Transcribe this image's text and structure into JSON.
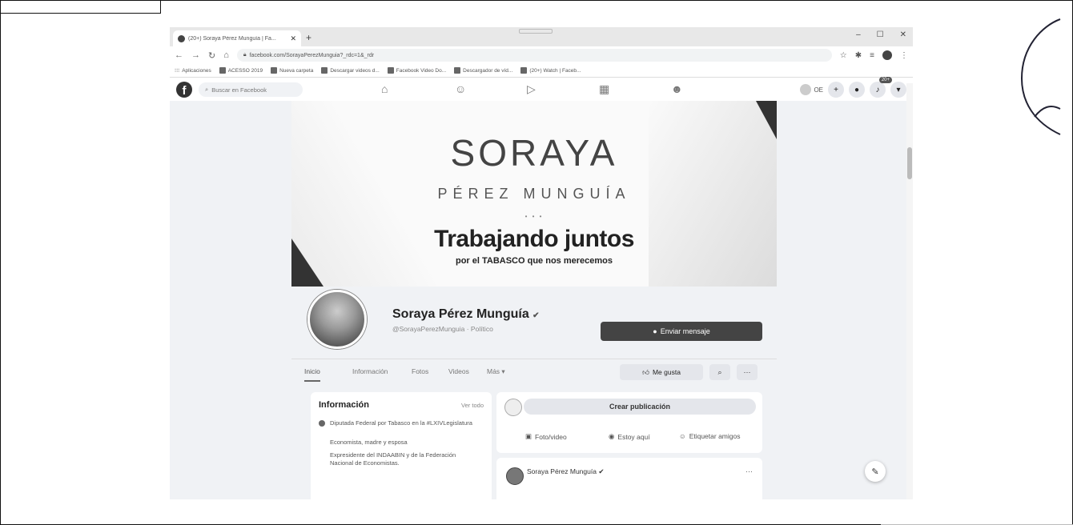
{
  "browser": {
    "tab_title": "(20+) Soraya Pérez Munguía | Fa...",
    "tab_close": "✕",
    "new_tab": "+",
    "url": "facebook.com/SorayaPerezMunguia?_rdc=1&_rdr",
    "window_controls": [
      "–",
      "☐",
      "✕"
    ]
  },
  "bookmarks": [
    "Aplicaciones",
    "ACESSO 2019",
    "Nueva carpeta",
    "Descargar videos d...",
    "Facebook Video Do...",
    "Descargador de víd...",
    "(20+) Watch | Faceb..."
  ],
  "fb": {
    "search_placeholder": "Buscar en Facebook",
    "user_short": "OE",
    "notifications_badge": "20+"
  },
  "cover": {
    "brand_name": "SORAYA",
    "brand_subtitle": "PÉREZ MUNGUÍA",
    "slogan": "Trabajando juntos",
    "slogan_sub": "por el TABASCO que nos merecemos"
  },
  "profile": {
    "name": "Soraya Pérez Munguía",
    "handle": "@SorayaPerezMunguia · Político",
    "message_button": "Enviar mensaje"
  },
  "tabs": [
    "Inicio",
    "Información",
    "Fotos",
    "Videos",
    "Más ▾"
  ],
  "actions": {
    "like": "Me gusta",
    "search": "⌕",
    "more": "···"
  },
  "info": {
    "title": "Información",
    "see_all": "Ver todo",
    "lines": [
      "Diputada Federal por Tabasco en la #LXIVLegislatura",
      "Economista, madre y esposa",
      "Expresidente del INDAABIN y de la Federación Nacional de Economistas."
    ]
  },
  "create_post": {
    "button": "Crear publicación",
    "actions": [
      "Foto/video",
      "Estoy aquí",
      "Etiquetar amigos"
    ]
  },
  "post": {
    "author": "Soraya Pérez Munguía",
    "more": "···"
  }
}
